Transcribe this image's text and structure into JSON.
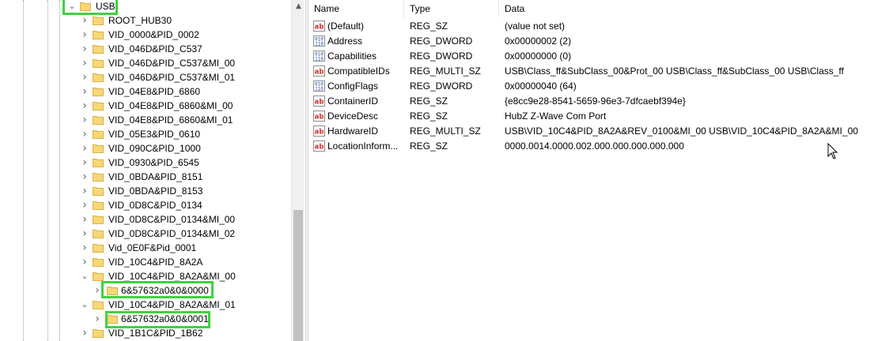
{
  "tree": {
    "top": {
      "label": "USB",
      "expanded": true
    },
    "children": [
      {
        "label": "ROOT_HUB30",
        "chevron": "right"
      },
      {
        "label": "VID_0000&PID_0002",
        "chevron": "right"
      },
      {
        "label": "VID_046D&PID_C537",
        "chevron": "right"
      },
      {
        "label": "VID_046D&PID_C537&MI_00",
        "chevron": "right"
      },
      {
        "label": "VID_046D&PID_C537&MI_01",
        "chevron": "right"
      },
      {
        "label": "VID_04E8&PID_6860",
        "chevron": "right"
      },
      {
        "label": "VID_04E8&PID_6860&MI_00",
        "chevron": "right"
      },
      {
        "label": "VID_04E8&PID_6860&MI_01",
        "chevron": "right"
      },
      {
        "label": "VID_05E3&PID_0610",
        "chevron": "right"
      },
      {
        "label": "VID_090C&PID_1000",
        "chevron": "right"
      },
      {
        "label": "VID_0930&PID_6545",
        "chevron": "right"
      },
      {
        "label": "VID_0BDA&PID_8151",
        "chevron": "right"
      },
      {
        "label": "VID_0BDA&PID_8153",
        "chevron": "right"
      },
      {
        "label": "VID_0D8C&PID_0134",
        "chevron": "right"
      },
      {
        "label": "VID_0D8C&PID_0134&MI_00",
        "chevron": "right"
      },
      {
        "label": "VID_0D8C&PID_0134&MI_02",
        "chevron": "right"
      },
      {
        "label": "Vid_0E0F&Pid_0001",
        "chevron": "right"
      },
      {
        "label": "VID_10C4&PID_8A2A",
        "chevron": "right"
      },
      {
        "label": "VID_10C4&PID_8A2A&MI_00",
        "chevron": "down"
      },
      {
        "label": "6&57632a0&0&0000",
        "chevron": "right",
        "child": true
      },
      {
        "label": "VID_10C4&PID_8A2A&MI_01",
        "chevron": "down"
      },
      {
        "label": "6&57632a0&0&0001",
        "chevron": "right",
        "child": true
      },
      {
        "label": "VID_1B1C&PID_1B62",
        "chevron": "right"
      }
    ]
  },
  "columns": {
    "name": "Name",
    "type": "Type",
    "data": "Data"
  },
  "values": [
    {
      "icon": "string-value-icon",
      "name": "(Default)",
      "type": "REG_SZ",
      "data": "(value not set)"
    },
    {
      "icon": "binary-value-icon",
      "name": "Address",
      "type": "REG_DWORD",
      "data": "0x00000002 (2)"
    },
    {
      "icon": "binary-value-icon",
      "name": "Capabilities",
      "type": "REG_DWORD",
      "data": "0x00000000 (0)"
    },
    {
      "icon": "string-value-icon",
      "name": "CompatibleIDs",
      "type": "REG_MULTI_SZ",
      "data": "USB\\Class_ff&SubClass_00&Prot_00 USB\\Class_ff&SubClass_00 USB\\Class_ff"
    },
    {
      "icon": "binary-value-icon",
      "name": "ConfigFlags",
      "type": "REG_DWORD",
      "data": "0x00000040 (64)"
    },
    {
      "icon": "string-value-icon",
      "name": "ContainerID",
      "type": "REG_SZ",
      "data": "{e8cc9e28-8541-5659-96e3-7dfcaebf394e}"
    },
    {
      "icon": "string-value-icon",
      "name": "DeviceDesc",
      "type": "REG_SZ",
      "data": "HubZ Z-Wave Com Port"
    },
    {
      "icon": "string-value-icon",
      "name": "HardwareID",
      "type": "REG_MULTI_SZ",
      "data": "USB\\VID_10C4&PID_8A2A&REV_0100&MI_00 USB\\VID_10C4&PID_8A2A&MI_00"
    },
    {
      "icon": "string-value-icon",
      "name": "LocationInform...",
      "type": "REG_SZ",
      "data": "0000.0014.0000.002.000.000.000.000.000"
    }
  ],
  "colors": {
    "highlight": "#3fd23f",
    "folder": "#f8d775"
  }
}
